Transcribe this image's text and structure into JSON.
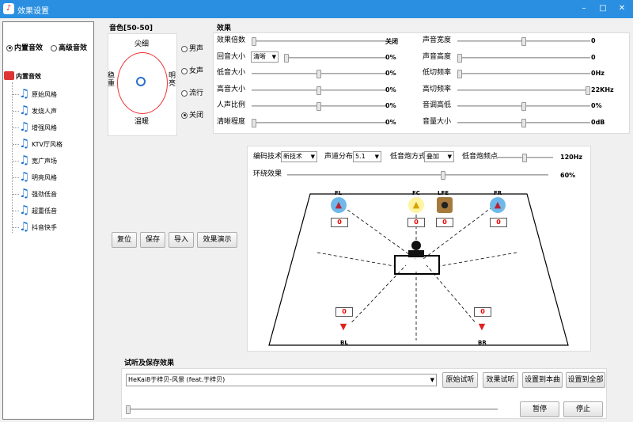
{
  "window": {
    "title": "效果设置",
    "min": "–",
    "max": "□",
    "close": "✕"
  },
  "mode": {
    "builtin": "内置音效",
    "advanced": "高级音效"
  },
  "tree": {
    "root": "内置音效",
    "items": [
      "原始风格",
      "发烧人声",
      "增强风格",
      "KTV厅风格",
      "宽广声场",
      "明亮风格",
      "强劲低音",
      "超重低音",
      "抖音快手"
    ]
  },
  "tone": {
    "title": "音色[50-50]",
    "top": "尖细",
    "bottom": "温暖",
    "left": "稳重",
    "right": "明亮",
    "voices": [
      "男声",
      "女声",
      "流行",
      "关闭"
    ],
    "selected_voice": "关闭"
  },
  "effect": {
    "title": "效果",
    "left_rows": [
      {
        "label": "效果倍数",
        "value": "关闭",
        "level": 0
      },
      {
        "label": "回音大小",
        "value": "0%",
        "level": 0,
        "select": "清晰"
      },
      {
        "label": "低音大小",
        "value": "0%",
        "level": 0.5
      },
      {
        "label": "高音大小",
        "value": "0%",
        "level": 0.5
      },
      {
        "label": "人声比例",
        "value": "0%",
        "level": 0.5
      },
      {
        "label": "清晰程度",
        "value": "0%",
        "level": 0
      }
    ],
    "right_rows": [
      {
        "label": "声音宽度",
        "value": "0",
        "level": 0.5
      },
      {
        "label": "声音高度",
        "value": "0",
        "level": 0
      },
      {
        "label": "低切频率",
        "value": "0Hz",
        "level": 0
      },
      {
        "label": "高切频率",
        "value": "22KHz",
        "level": 1
      },
      {
        "label": "音调高低",
        "value": "0%",
        "level": 0.5
      },
      {
        "label": "音量大小",
        "value": "0dB",
        "level": 0.5
      }
    ]
  },
  "surround": {
    "codec_label": "编码技术",
    "codec": "新技术",
    "dist_label": "声道分布",
    "dist": "5.1",
    "bass_label": "低音炮方式",
    "bass": "叠加",
    "freq_label": "低音炮频点",
    "freq_value": "120Hz",
    "freq_level": 0.5,
    "env_label": "环绕效果",
    "env_value": "60%",
    "env_level": 0.6,
    "speakers": {
      "FL": "0",
      "FC": "0",
      "LFE": "0",
      "FR": "0",
      "BL": "0",
      "BR": "0"
    }
  },
  "buttons": {
    "reset": "复位",
    "save": "保存",
    "import": "导入",
    "demo": "效果演示"
  },
  "preview": {
    "title": "试听及保存效果",
    "song": "HeKai8于梓贝-风景 (feat.于梓贝)",
    "original": "原始试听",
    "effect": "效果试听",
    "set_song": "设置到本曲",
    "set_all": "设置到全部",
    "pause": "暂停",
    "stop": "停止"
  }
}
